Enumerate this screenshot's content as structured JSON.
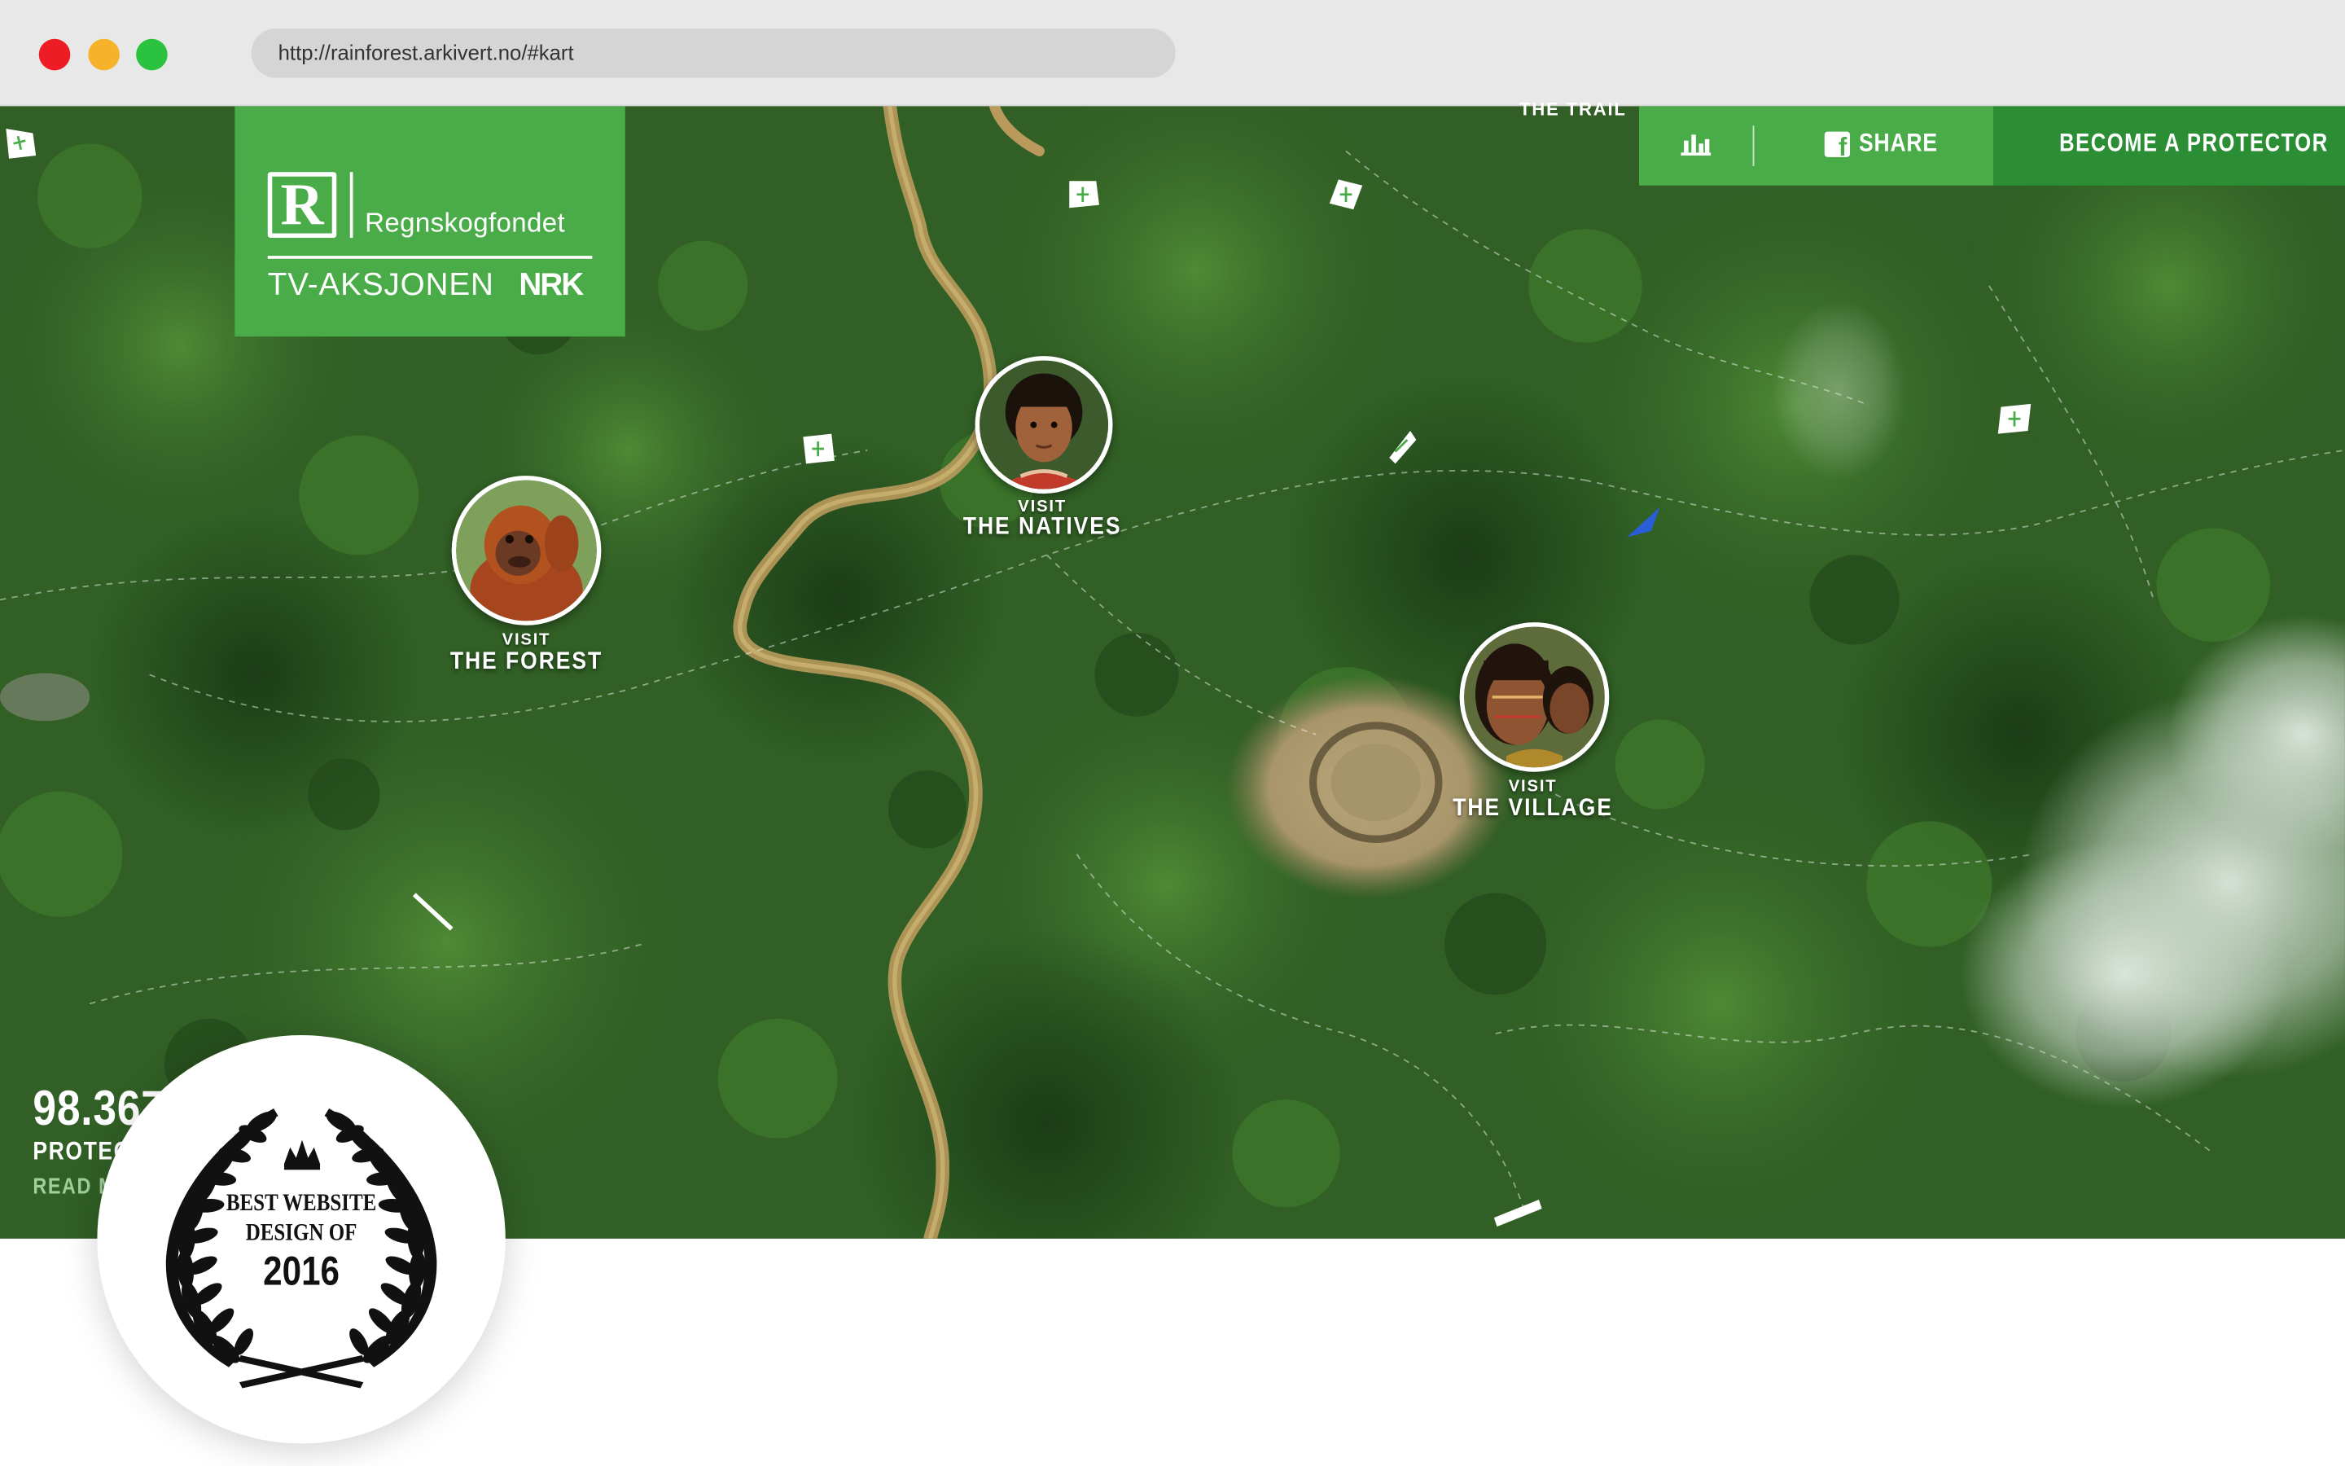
{
  "browser": {
    "url": "http://rainforest.arkivert.no/#kart"
  },
  "logo": {
    "mark": "R",
    "name": "Regnskogfondet",
    "campaign": "TV-AKSJONEN",
    "broadcaster": "NRK"
  },
  "nav": {
    "stats_icon": "bar-chart-icon",
    "share_icon": "facebook-icon",
    "share_label": "SHARE",
    "cta_label": "BECOME A PROTECTOR",
    "trail_label": "THE TRAIL"
  },
  "map": {
    "markers": [
      {
        "visit": "VISIT",
        "place": "THE FOREST"
      },
      {
        "visit": "VISIT",
        "place": "THE NATIVES"
      },
      {
        "visit": "VISIT",
        "place": "THE VILLAGE"
      }
    ]
  },
  "stats": {
    "count": "98.367",
    "label": "PROTECTORS",
    "link": "READ MORE"
  },
  "award": {
    "line1": "BEST WEBSITE",
    "line2": "DESIGN OF",
    "year": "2016",
    "icon": "crown-icon"
  },
  "colors": {
    "brand_green": "#4aac48",
    "brand_green_dark": "#2b8e34",
    "forest": "#2e5a23"
  }
}
